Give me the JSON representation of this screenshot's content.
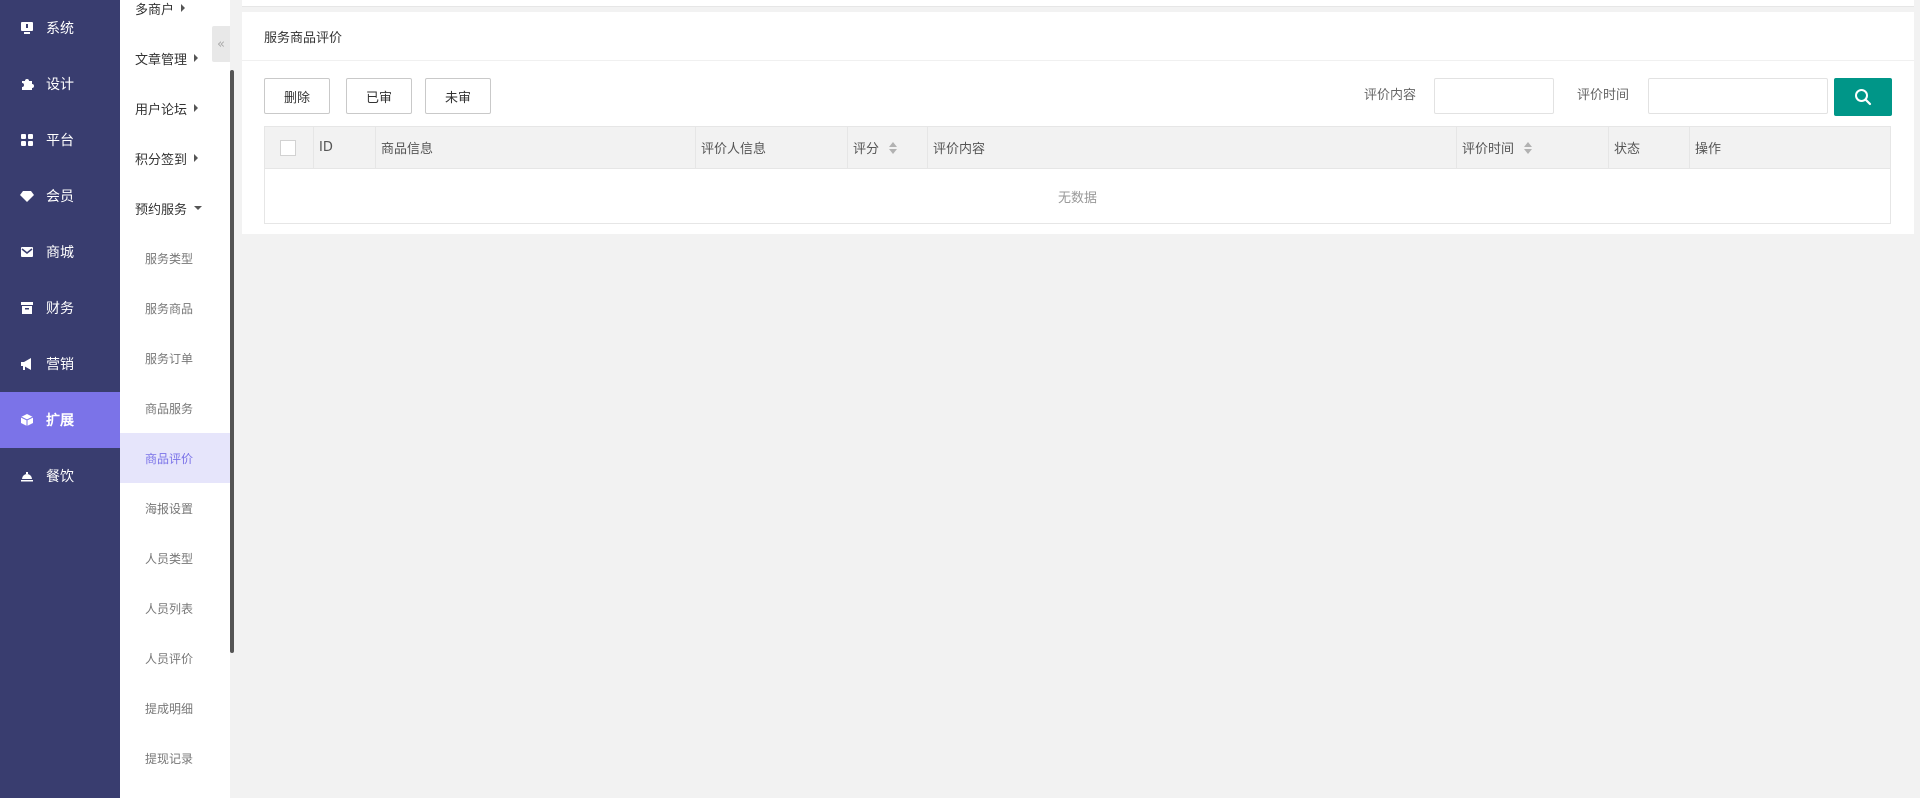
{
  "primary_nav": [
    {
      "label": "系统",
      "icon": "monitor-icon"
    },
    {
      "label": "设计",
      "icon": "puzzle-icon"
    },
    {
      "label": "平台",
      "icon": "grid-icon"
    },
    {
      "label": "会员",
      "icon": "diamond-icon"
    },
    {
      "label": "商城",
      "icon": "mail-icon"
    },
    {
      "label": "财务",
      "icon": "archive-icon"
    },
    {
      "label": "营销",
      "icon": "megaphone-icon"
    },
    {
      "label": "扩展",
      "icon": "cube-icon",
      "active": true
    },
    {
      "label": "餐饮",
      "icon": "dish-icon"
    }
  ],
  "secondary_nav": {
    "groups": [
      {
        "label": "多商户"
      },
      {
        "label": "文章管理"
      },
      {
        "label": "用户论坛"
      },
      {
        "label": "积分签到"
      },
      {
        "label": "预约服务",
        "expanded": true
      }
    ],
    "items": [
      {
        "label": "服务类型"
      },
      {
        "label": "服务商品"
      },
      {
        "label": "服务订单"
      },
      {
        "label": "商品服务"
      },
      {
        "label": "商品评价",
        "active": true
      },
      {
        "label": "海报设置"
      },
      {
        "label": "人员类型"
      },
      {
        "label": "人员列表"
      },
      {
        "label": "人员评价"
      },
      {
        "label": "提成明细"
      },
      {
        "label": "提现记录"
      }
    ],
    "collapse_glyph": "«"
  },
  "panel": {
    "title": "服务商品评价",
    "buttons": {
      "delete": "删除",
      "approved": "已审",
      "unapproved": "未审"
    },
    "filters": {
      "content_label": "评价内容",
      "time_label": "评价时间",
      "content_value": "",
      "time_value": ""
    },
    "table": {
      "columns": [
        "ID",
        "商品信息",
        "评价人信息",
        "评分",
        "评价内容",
        "评价时间",
        "状态",
        "操作"
      ],
      "empty_text": "无数据"
    }
  },
  "colors": {
    "sidebar_bg": "#393d6f",
    "sidebar_active": "#7b73e8",
    "search_button": "#009688"
  }
}
